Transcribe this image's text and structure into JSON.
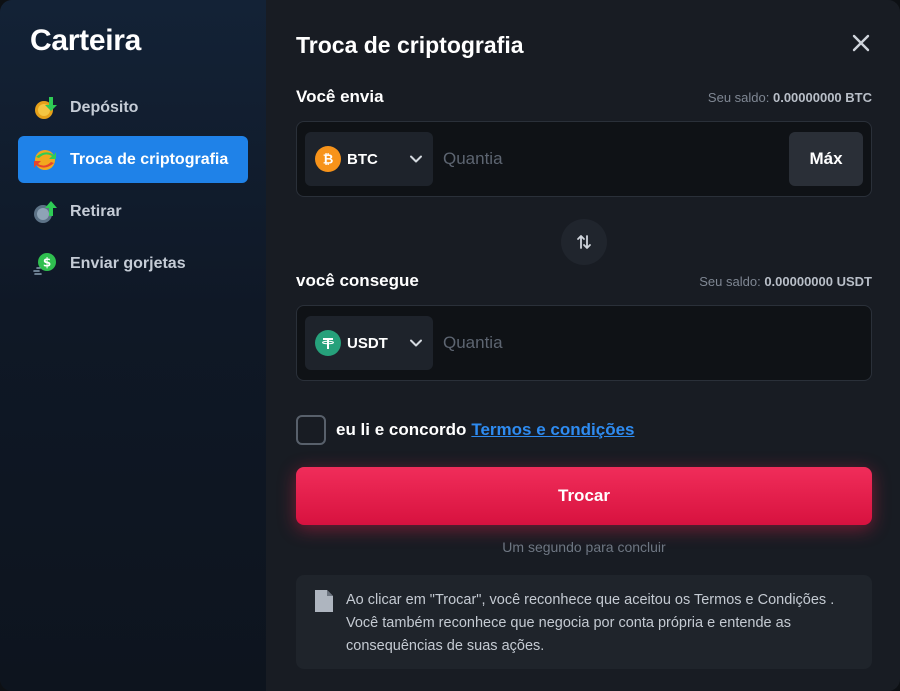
{
  "sidebar": {
    "title": "Carteira",
    "items": [
      {
        "label": "Depósito",
        "icon": "deposit-coin-icon",
        "active": false
      },
      {
        "label": "Troca de criptografia",
        "icon": "crypto-exchange-icon",
        "active": true
      },
      {
        "label": "Retirar",
        "icon": "withdraw-coin-icon",
        "active": false
      },
      {
        "label": "Enviar gorjetas",
        "icon": "tip-money-icon",
        "active": false
      }
    ]
  },
  "main": {
    "title": "Troca de criptografia",
    "close_icon": "close-icon",
    "send": {
      "label": "Você envia",
      "balance_label": "Seu saldo:",
      "balance_value": "0.00000000 BTC",
      "coin": "BTC",
      "coin_icon": "bitcoin-icon",
      "placeholder": "Quantia",
      "max_label": "Máx"
    },
    "swap_icon": "swap-arrows-icon",
    "receive": {
      "label": "você consegue",
      "balance_label": "Seu saldo:",
      "balance_value": "0.00000000 USDT",
      "coin": "USDT",
      "coin_icon": "tether-icon",
      "placeholder": "Quantia"
    },
    "terms": {
      "text": "eu li e concordo",
      "link": "Termos e condições",
      "checked": false
    },
    "submit_label": "Trocar",
    "hint": "Um segundo para concluir",
    "notice": {
      "icon": "document-icon",
      "text": "Ao clicar em \"Trocar\", você reconhece que aceitou os Termos e Condições . Você também reconhece que negocia por conta própria e entende as consequências de suas ações."
    }
  },
  "colors": {
    "accent_blue": "#1f82e8",
    "submit_red": "#e81e4a",
    "link_blue": "#2e8bf0",
    "bitcoin_orange": "#f7931a",
    "tether_green": "#26a17b"
  }
}
